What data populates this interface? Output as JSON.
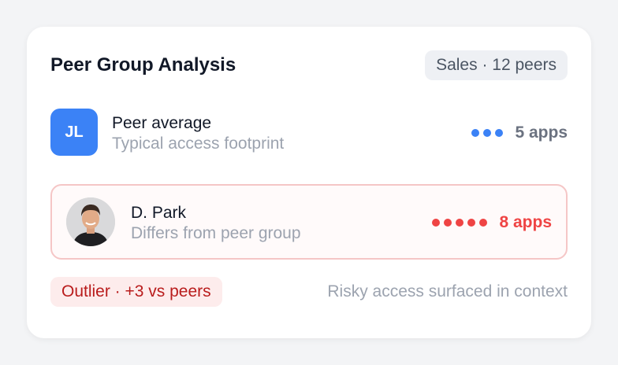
{
  "card": {
    "title": "Peer Group Analysis",
    "group_badge": "Sales · 12 peers"
  },
  "peer_row": {
    "initials": "JL",
    "title": "Peer average",
    "subtitle": "Typical access footprint",
    "app_count": 5,
    "app_label": "5 apps",
    "dot_color": "#3b82f6"
  },
  "user_row": {
    "name": "D. Park",
    "subtitle": "Differs from peer group",
    "app_count": 8,
    "app_label": "8 apps",
    "dot_color": "#ef4444"
  },
  "footer": {
    "outlier_badge": "Outlier · +3 vs peers",
    "note": "Risky access surfaced in context"
  },
  "colors": {
    "accent_blue": "#3b82f6",
    "alert_red": "#ef4444",
    "alert_dark_red": "#b91c1c"
  }
}
